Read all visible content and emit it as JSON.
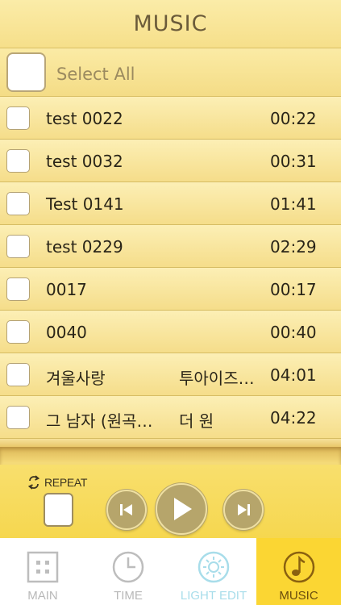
{
  "header": {
    "title": "MUSIC"
  },
  "select_all": {
    "label": "Select All",
    "checked": false
  },
  "tracks": [
    {
      "name": "test 0022",
      "artist": "",
      "duration": "00:22",
      "checked": false
    },
    {
      "name": "test 0032",
      "artist": "",
      "duration": "00:31",
      "checked": false
    },
    {
      "name": "Test 0141",
      "artist": "",
      "duration": "01:41",
      "checked": false
    },
    {
      "name": "test 0229",
      "artist": "",
      "duration": "02:29",
      "checked": false
    },
    {
      "name": "0017",
      "artist": "",
      "duration": "00:17",
      "checked": false
    },
    {
      "name": "0040",
      "artist": "",
      "duration": "00:40",
      "checked": false
    },
    {
      "name": "겨울사랑",
      "artist": "투아이즈…",
      "duration": "04:01",
      "checked": false
    },
    {
      "name": "그 남자 (원곡…",
      "artist": "더 원",
      "duration": "04:22",
      "checked": false
    }
  ],
  "controls": {
    "repeat_label": "REPEAT",
    "repeat_checked": false,
    "icons": {
      "repeat": "repeat-icon",
      "prev": "skip-previous-icon",
      "play": "play-icon",
      "next": "skip-next-icon"
    }
  },
  "tabs": [
    {
      "id": "main",
      "label": "MAIN",
      "icon": "grid-icon",
      "active": false
    },
    {
      "id": "time",
      "label": "TIME",
      "icon": "clock-icon",
      "active": false
    },
    {
      "id": "light",
      "label": "LIGHT EDIT",
      "icon": "sun-icon",
      "active": false
    },
    {
      "id": "music",
      "label": "MUSIC",
      "icon": "music-note-icon",
      "active": true
    }
  ],
  "colors": {
    "accent": "#fbd633",
    "list_bg": "#f7e289",
    "button": "#b6a56b",
    "light_tab": "#a8ddea",
    "music_tab_icon": "#8a6110"
  }
}
